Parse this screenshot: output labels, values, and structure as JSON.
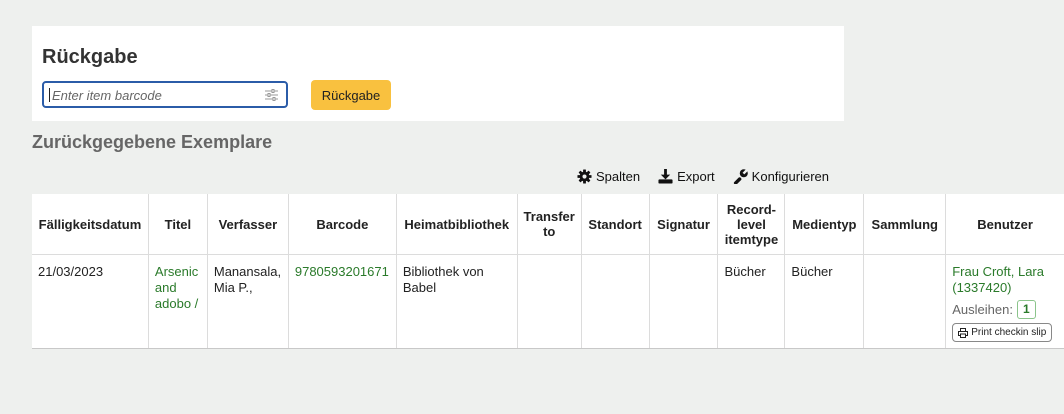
{
  "checkin": {
    "title": "Rückgabe",
    "barcode_placeholder": "Enter item barcode",
    "submit_label": "Rückgabe"
  },
  "returned": {
    "title": "Zurückgegebene Exemplare",
    "toolbar": {
      "columns_label": "Spalten",
      "export_label": "Export",
      "configure_label": "Konfigurieren"
    },
    "headers": [
      "Fälligkeitsdatum",
      "Titel",
      "Verfasser",
      "Barcode",
      "Heimatbibliothek",
      "Transfer to",
      "Standort",
      "Signatur",
      "Record-level itemtype",
      "Medientyp",
      "Sammlung",
      "Benutzer"
    ],
    "rows": [
      {
        "due_date": "21/03/2023",
        "title": "Arsenic and adobo /",
        "author": "Manansala, Mia P.,",
        "barcode": "9780593201671",
        "home_library": "Bibliothek von Babel",
        "transfer_to": "",
        "location": "",
        "call_number": "",
        "record_itemtype": "Bücher",
        "item_type": "Bücher",
        "collection": "",
        "patron_name": "Frau Croft, Lara (1337420)",
        "loans_label": "Ausleihen:",
        "loans_count": "1",
        "print_slip_label": "Print checkin slip"
      }
    ]
  }
}
